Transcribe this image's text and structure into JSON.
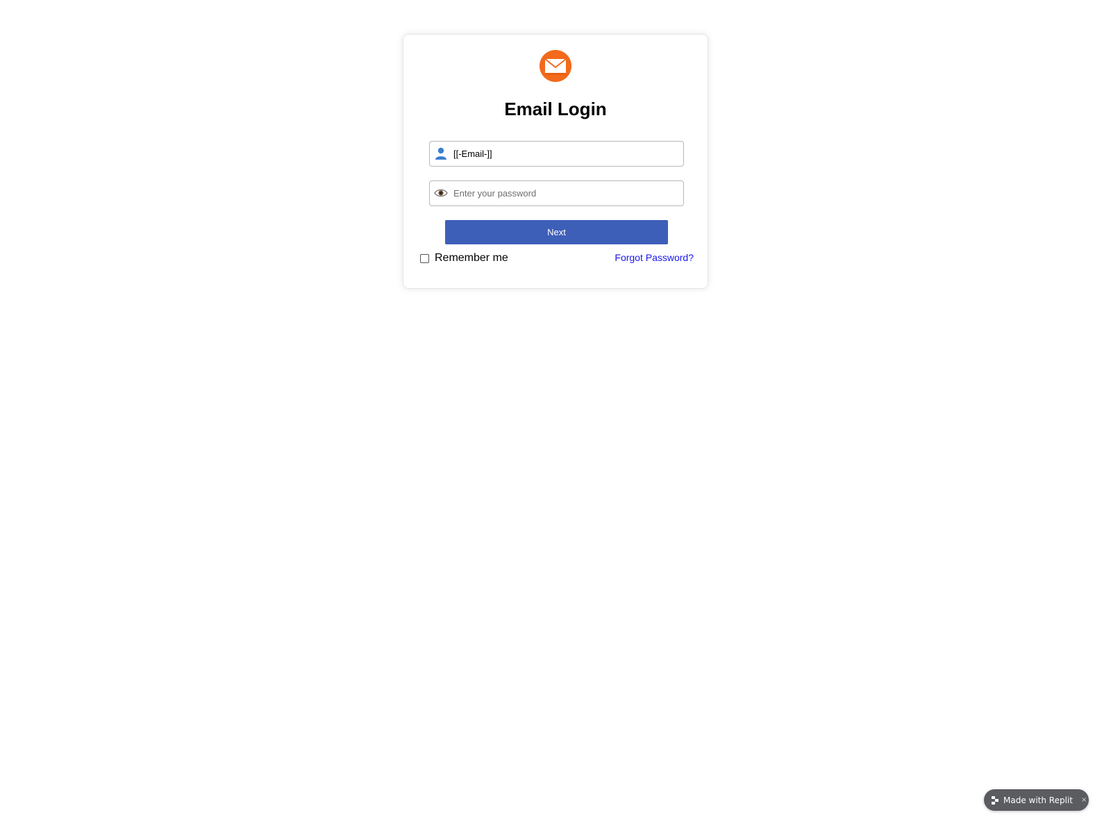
{
  "login": {
    "title": "Email Login",
    "email": {
      "value": "[[-Email-]]",
      "icon": "user-icon"
    },
    "password": {
      "placeholder": "Enter your password",
      "icon": "eye-icon"
    },
    "next_label": "Next",
    "remember_label": "Remember me",
    "forgot_label": "Forgot Password?"
  },
  "badge": {
    "label": "Made with Replit",
    "close": "×"
  },
  "colors": {
    "logo": "#f26a1b",
    "button": "#3d5fb8",
    "link": "#1a17e8",
    "badge": "#5a5c5f"
  }
}
